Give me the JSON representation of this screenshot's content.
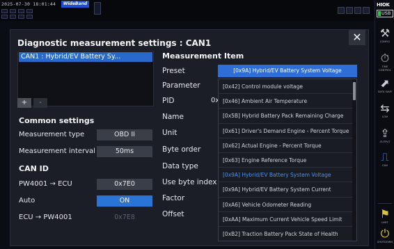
{
  "status": {
    "datetime": "2025-07-30 18:01:44",
    "mode_badge": "WideBand"
  },
  "sidebar": {
    "brand": "HIOK",
    "usb_label": "USB",
    "buttons": [
      {
        "icon": "wrench-config-icon",
        "label": "CONFIG"
      },
      {
        "icon": "timer-control-icon",
        "label": "TIME CONTROL"
      },
      {
        "icon": "data-save-icon",
        "label": "DATA SAVE"
      },
      {
        "icon": "com-icon",
        "label": "COM"
      },
      {
        "icon": "output-icon",
        "label": "OUTPUT"
      },
      {
        "icon": "can-icon",
        "label": "CAN"
      },
      {
        "icon": "limit-icon",
        "label": "LIMIT"
      },
      {
        "icon": "shutdown-icon",
        "label": "SHUTDOWN"
      }
    ]
  },
  "dialog": {
    "title": "Diagnostic measurement settings : CAN1",
    "channel_item": "CAN1 : Hybrid/EV Battery Sy...",
    "add_label": "+",
    "remove_label": "-",
    "common": {
      "title": "Common settings",
      "measurement_type_label": "Measurement type",
      "measurement_type_value": "OBD II",
      "measurement_interval_label": "Measurement interval",
      "measurement_interval_value": "50ms"
    },
    "can_id": {
      "title": "CAN ID",
      "pw_to_ecu_label": "PW4001 → ECU",
      "pw_to_ecu_value": "0x7E0",
      "auto_label": "Auto",
      "auto_value": "ON",
      "ecu_to_pw_label": "ECU → PW4001",
      "ecu_to_pw_value": "0x7E8"
    },
    "measurement_item": {
      "title": "Measurement Item",
      "preset_label": "Preset",
      "preset_value": "[0x9A] Hybrid/EV Battery System Voltage",
      "parameter_label": "Parameter",
      "pid_label": "PID",
      "pid_prefix": "0x",
      "name_label": "Name",
      "unit_label": "Unit",
      "byte_order_label": "Byte order",
      "data_type_label": "Data type",
      "use_byte_index_label": "Use byte index",
      "factor_label": "Factor",
      "offset_label": "Offset"
    },
    "preset_options": [
      "[0x42] Control module voltage",
      "[0x46] Ambient Air Temperature",
      "[0x5B] Hybrid Battery Pack Remaining Charge",
      "[0x61] Driver's Demand Engine - Percent Torque",
      "[0x62] Actual Engine - Percent Torque",
      "[0x63] Engine Reference Torque",
      "[0x9A] Hybrid/EV Battery System Voltage",
      "[0x9A] Hybrid/EV Battery System Current",
      "[0xA6] Vehicle Odometer Reading",
      "[0xAA] Maximum Current Vehicle Speed Limit",
      "[0xB2] Traction Battery Pack State of Health"
    ],
    "selected_option_index": 6
  },
  "colors": {
    "accent": "#2a74d8",
    "dialog_bg": "#1b1e27",
    "selected_text": "#4a93f0"
  }
}
